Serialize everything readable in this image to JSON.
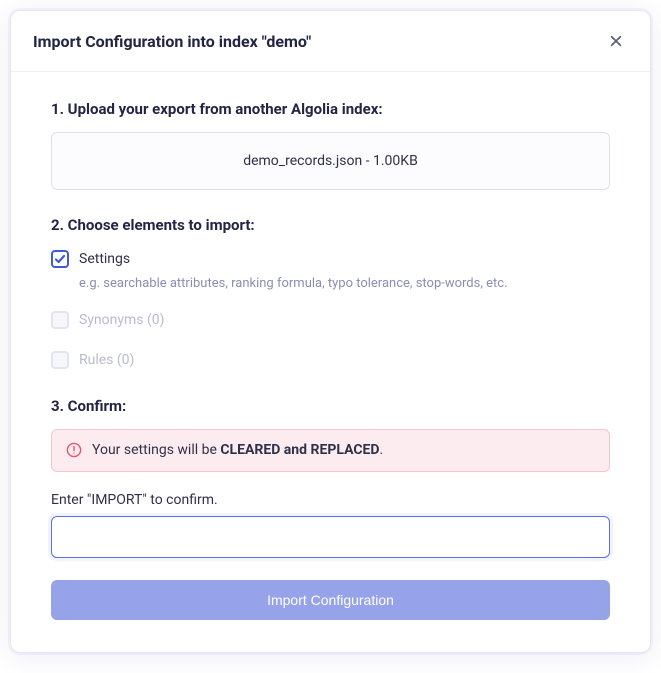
{
  "modal": {
    "title": "Import Configuration into index \"demo\""
  },
  "step1": {
    "heading": "1. Upload your export from another Algolia index:",
    "file": "demo_records.json - 1.00KB"
  },
  "step2": {
    "heading": "2. Choose elements to import:",
    "settings": {
      "label": "Settings",
      "desc": "e.g. searchable attributes, ranking formula, typo tolerance, stop-words, etc."
    },
    "synonyms_label": "Synonyms (0)",
    "rules_label": "Rules (0)"
  },
  "step3": {
    "heading": "3. Confirm:",
    "warning_prefix": "Your settings will be ",
    "warning_bold": "CLEARED and REPLACED",
    "warning_suffix": ".",
    "confirm_label": "Enter \"IMPORT\" to confirm.",
    "button": "Import Configuration"
  }
}
